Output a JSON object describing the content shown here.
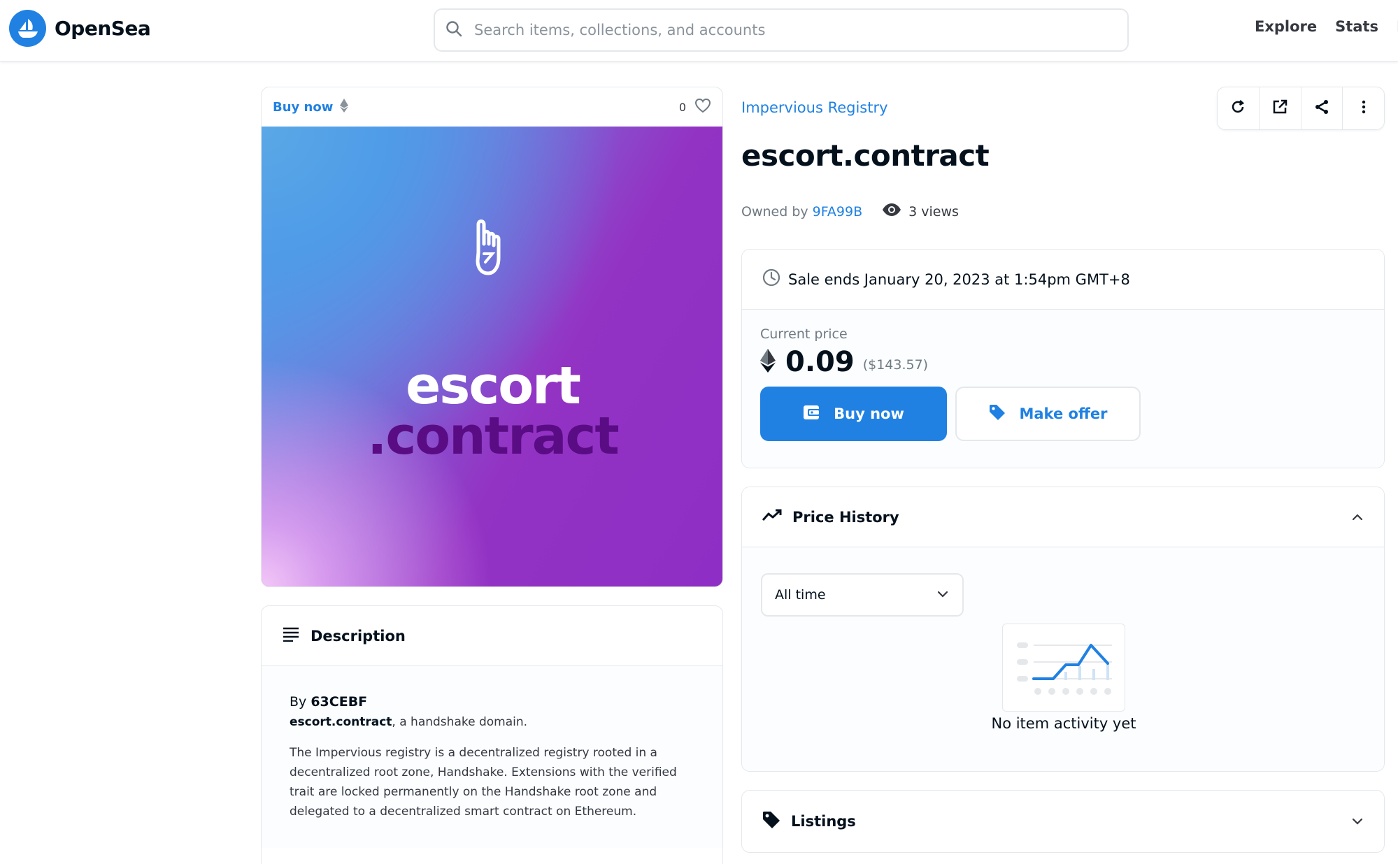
{
  "header": {
    "logo_text": "OpenSea",
    "search_placeholder": "Search items, collections, and accounts",
    "nav": [
      "Explore",
      "Stats",
      "Re"
    ]
  },
  "media": {
    "buy_now_label": "Buy now",
    "favorites_count": "0",
    "art_word_1": "escort",
    "art_word_2": ".contract"
  },
  "description": {
    "heading": "Description",
    "by_prefix": "By",
    "creator": "63CEBF",
    "domain_name": "escort.contract",
    "domain_suffix": ", a handshake domain.",
    "body": "The Impervious registry is a decentralized registry rooted in a decentralized root zone, Handshake. Extensions with the verified trait are locked permanently on the Handshake root zone and delegated to a decentralized smart contract on Ethereum."
  },
  "item": {
    "collection": "Impervious Registry",
    "title": "escort.contract",
    "owned_by_label": "Owned by",
    "owner": "9FA99B",
    "views": "3 views"
  },
  "sale": {
    "ends_text": "Sale ends January 20, 2023 at 1:54pm GMT+8",
    "current_price_label": "Current price",
    "price": "0.09",
    "price_usd": "($143.57)",
    "buy_now_button": "Buy now",
    "make_offer_button": "Make offer"
  },
  "price_history": {
    "heading": "Price History",
    "range_selected": "All time",
    "empty_text": "No item activity yet"
  },
  "listings": {
    "heading": "Listings"
  },
  "colors": {
    "accent": "#2081e2",
    "text": "#04111d",
    "muted": "#707a83",
    "border": "#e5e8eb"
  }
}
